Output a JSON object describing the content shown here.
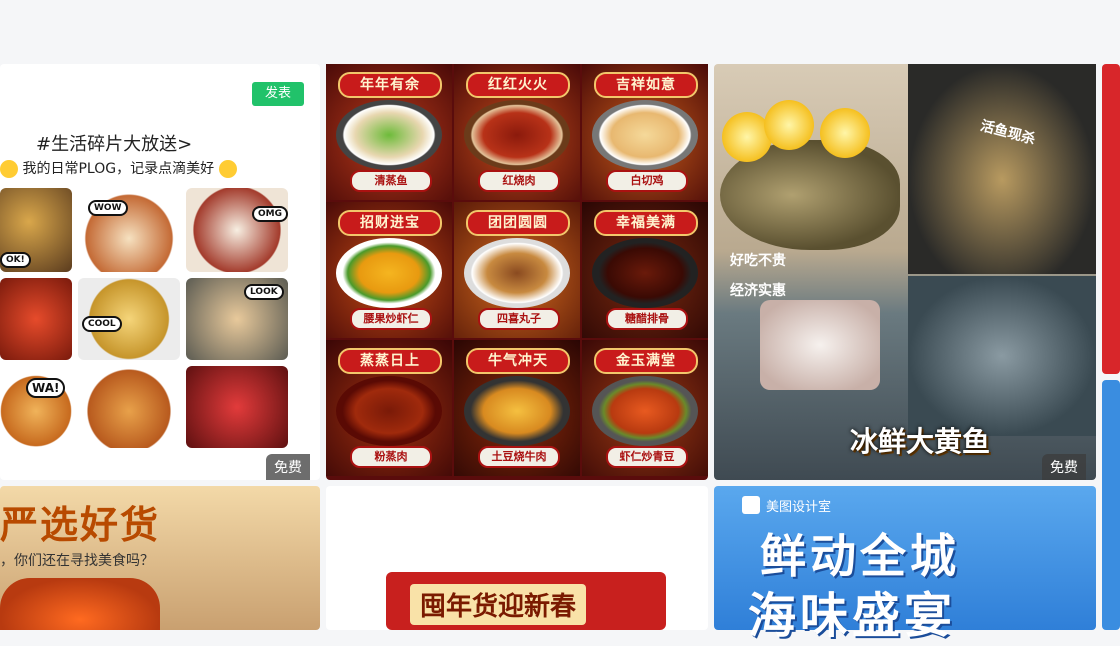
{
  "card1": {
    "publish_label": "发表",
    "title": "#生活碎片大放送>",
    "subtitle": "我的日常PLOG，记录点滴美好",
    "stickers": [
      "WOW",
      "OMG",
      "OK!",
      "LOOK",
      "COOL",
      "WA!"
    ],
    "badge": "免费"
  },
  "card2": {
    "titles": [
      "年年有余",
      "红红火火",
      "吉祥如意",
      "招财进宝",
      "团团圆圆",
      "幸福美满",
      "蒸蒸日上",
      "牛气冲天",
      "金玉满堂"
    ],
    "labels": [
      "清蒸鱼",
      "红烧肉",
      "白切鸡",
      "腰果炒虾仁",
      "四喜丸子",
      "糖醋排骨",
      "粉蒸肉",
      "土豆烧牛肉",
      "虾仁炒青豆"
    ]
  },
  "card3": {
    "tag_alive": "活鱼现杀",
    "tag_tasty": "好吃不贵",
    "tag_value": "经济实惠",
    "headline": "冰鲜大黄鱼",
    "badge": "免费"
  },
  "bottom": {
    "b1_title": "严选好货",
    "b1_sub": "，你们还在寻找美食吗？",
    "b2_title": "囤年货迎新春",
    "b3_brand": "美图设计室",
    "b3_line1": "鲜动全城",
    "b3_line2": "海味盛宴"
  },
  "colors": {
    "accent_green": "#21c26a",
    "festive_red": "#c81b1b",
    "gold": "#f2c76b",
    "sea_blue": "#3a8de0"
  }
}
